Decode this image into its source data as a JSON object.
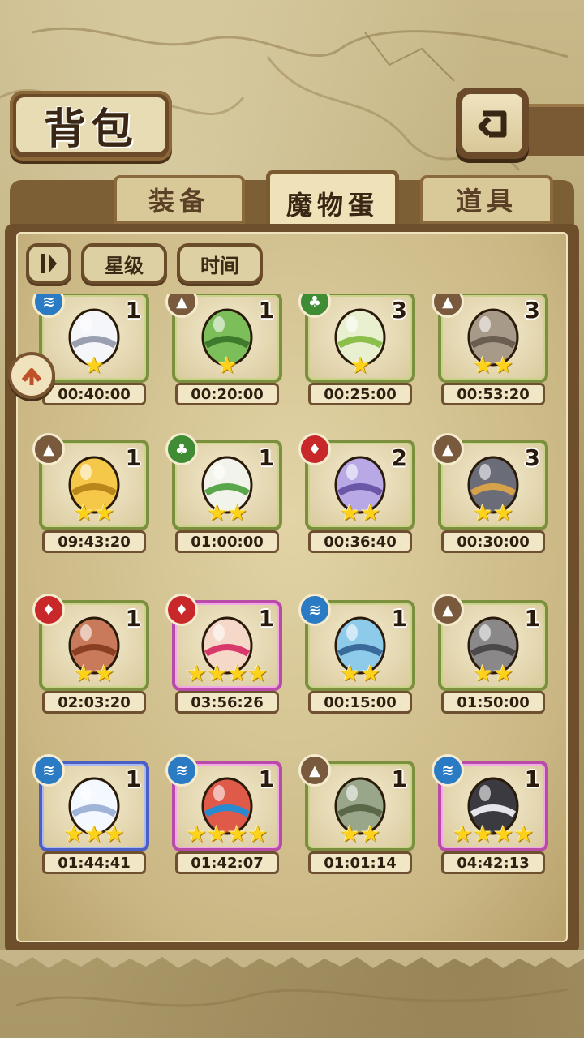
{
  "header": {
    "title": "背包"
  },
  "tabs": [
    {
      "label": "装备",
      "active": false
    },
    {
      "label": "魔物蛋",
      "active": true
    },
    {
      "label": "道具",
      "active": false
    }
  ],
  "sort": {
    "toggle_icon": "sort-toggle-icon",
    "star_label": "星级",
    "time_label": "时间"
  },
  "colors": {
    "frame_green": "#7b8f3e",
    "frame_pink": "#b84aa8",
    "frame_blue": "#4a5ec4",
    "star": "#ffd21a"
  },
  "eggs": [
    {
      "element": "water",
      "count": "1",
      "stars": 1,
      "time": "00:40:00",
      "frame": "green",
      "egg": "white-striped-egg"
    },
    {
      "element": "earth",
      "count": "1",
      "stars": 1,
      "time": "00:20:00",
      "frame": "green",
      "egg": "leaf-egg"
    },
    {
      "element": "grass",
      "count": "3",
      "stars": 1,
      "time": "00:25:00",
      "frame": "green",
      "egg": "sprout-egg"
    },
    {
      "element": "earth",
      "count": "3",
      "stars": 2,
      "time": "00:53:20",
      "frame": "green",
      "egg": "rock-egg"
    },
    {
      "element": "earth",
      "count": "1",
      "stars": 2,
      "time": "09:43:20",
      "frame": "green",
      "egg": "gold-egg"
    },
    {
      "element": "grass",
      "count": "1",
      "stars": 2,
      "time": "01:00:00",
      "frame": "green",
      "egg": "radish-egg"
    },
    {
      "element": "fire",
      "count": "2",
      "stars": 2,
      "time": "00:36:40",
      "frame": "green",
      "egg": "purple-bud-egg"
    },
    {
      "element": "earth",
      "count": "3",
      "stars": 2,
      "time": "00:30:00",
      "frame": "green",
      "egg": "hat-egg"
    },
    {
      "element": "fire",
      "count": "1",
      "stars": 2,
      "time": "02:03:20",
      "frame": "green",
      "egg": "flame-egg"
    },
    {
      "element": "fire",
      "count": "1",
      "stars": 4,
      "time": "03:56:26",
      "frame": "pink",
      "egg": "kimono-egg"
    },
    {
      "element": "water",
      "count": "1",
      "stars": 2,
      "time": "00:15:00",
      "frame": "green",
      "egg": "shell-egg"
    },
    {
      "element": "earth",
      "count": "1",
      "stars": 2,
      "time": "01:50:00",
      "frame": "green",
      "egg": "furry-egg"
    },
    {
      "element": "water",
      "count": "1",
      "stars": 3,
      "time": "01:44:41",
      "frame": "blue",
      "egg": "cloud-egg"
    },
    {
      "element": "water",
      "count": "1",
      "stars": 4,
      "time": "01:42:07",
      "frame": "pink",
      "egg": "feather-egg"
    },
    {
      "element": "earth",
      "count": "1",
      "stars": 2,
      "time": "01:01:14",
      "frame": "green",
      "egg": "seed-egg"
    },
    {
      "element": "water",
      "count": "1",
      "stars": 4,
      "time": "04:42:13",
      "frame": "pink",
      "egg": "spike-egg"
    }
  ]
}
